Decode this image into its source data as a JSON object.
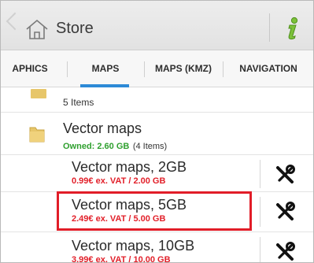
{
  "header": {
    "title": "Store",
    "icons": {
      "back": "chevron-left-icon",
      "home": "home-icon",
      "info": "info-icon"
    }
  },
  "tabs": [
    {
      "label": "APHICS"
    },
    {
      "label": "MAPS",
      "active": true
    },
    {
      "label": "MAPS (KMZ)"
    },
    {
      "label": "NAVIGATION"
    }
  ],
  "list": {
    "prev_folder": {
      "subtitle": "5 Items"
    },
    "folder": {
      "title": "Vector maps",
      "owned": "Owned: 2.60 GB",
      "items_count": "(4 Items)"
    },
    "items": [
      {
        "title": "Vector maps, 2GB",
        "price": "0.99€ ex. VAT / 2.00 GB"
      },
      {
        "title": "Vector maps, 5GB",
        "price": "2.49€ ex. VAT / 5.00 GB",
        "highlighted": true
      },
      {
        "title": "Vector maps, 10GB",
        "price": "3.99€ ex. VAT / 10.00 GB"
      }
    ]
  },
  "colors": {
    "accent": "#2d8ad6",
    "owned_green": "#2fa02f",
    "price_red": "#e2202a",
    "highlight_red": "#e11d28"
  }
}
